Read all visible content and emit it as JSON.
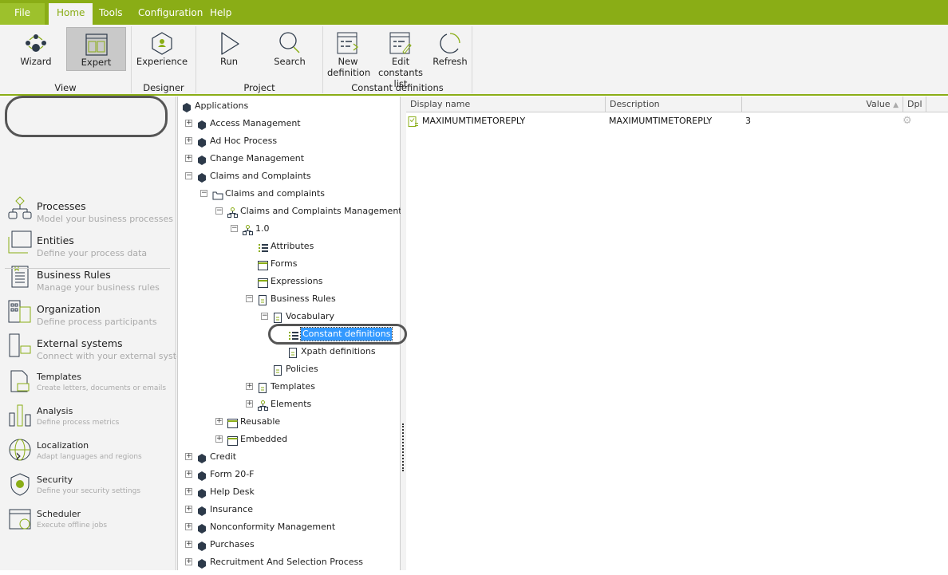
{
  "menu": {
    "tabs": [
      "File",
      "Home",
      "Tools",
      "Configuration",
      "Help"
    ],
    "active": "Home"
  },
  "ribbon": {
    "buttons": {
      "wizard": "Wizard",
      "expert": "Expert",
      "experience": "Experience",
      "run": "Run",
      "search": "Search",
      "new_definition": [
        "New",
        "definition"
      ],
      "edit_constants": [
        "Edit constants",
        "list"
      ],
      "refresh": "Refresh"
    },
    "groups": {
      "view": "View",
      "designer": "Designer",
      "project": "Project",
      "constant_definitions": "Constant definitions"
    }
  },
  "sidebar": {
    "items": [
      {
        "title": "Processes",
        "desc": "Model your business processes",
        "icon": "processes-icon"
      },
      {
        "title": "Entities",
        "desc": "Define your process data",
        "icon": "entities-icon"
      },
      {
        "title": "Business Rules",
        "desc": "Manage your business rules",
        "icon": "business-rules-icon"
      },
      {
        "title": "Organization",
        "desc": "Define process participants",
        "icon": "organization-icon"
      },
      {
        "title": "External systems",
        "desc": "Connect with your external systems",
        "icon": "external-systems-icon"
      },
      {
        "title": "Templates",
        "desc": "Create letters, documents  or emails",
        "icon": "templates-icon"
      },
      {
        "title": "Analysis",
        "desc": "Define process metrics",
        "icon": "analysis-icon"
      },
      {
        "title": "Localization",
        "desc": "Adapt languages and regions",
        "icon": "localization-icon"
      },
      {
        "title": "Security",
        "desc": "Define your security settings",
        "icon": "security-icon"
      },
      {
        "title": "Scheduler",
        "desc": "Execute offline jobs",
        "icon": "scheduler-icon"
      }
    ],
    "expand": "›"
  },
  "tree": [
    {
      "label": "Applications",
      "level": 0,
      "exp": "",
      "icon": "hex"
    },
    {
      "label": "Access Management",
      "level": 1,
      "exp": "+",
      "icon": "hex"
    },
    {
      "label": "Ad Hoc Process",
      "level": 1,
      "exp": "+",
      "icon": "hex"
    },
    {
      "label": "Change Management",
      "level": 1,
      "exp": "+",
      "icon": "hex"
    },
    {
      "label": "Claims and Complaints",
      "level": 1,
      "exp": "-",
      "icon": "hex"
    },
    {
      "label": "Claims and complaints",
      "level": 2,
      "exp": "-",
      "icon": "folder"
    },
    {
      "label": "Claims and Complaints Management",
      "level": 3,
      "exp": "-",
      "icon": "process"
    },
    {
      "label": "1.0",
      "level": 4,
      "exp": "-",
      "icon": "process"
    },
    {
      "label": "Attributes",
      "level": 5,
      "exp": "",
      "icon": "list"
    },
    {
      "label": "Forms",
      "level": 5,
      "exp": "",
      "icon": "form"
    },
    {
      "label": "Expressions",
      "level": 5,
      "exp": "",
      "icon": "form"
    },
    {
      "label": "Business Rules",
      "level": 5,
      "exp": "-",
      "icon": "doc"
    },
    {
      "label": "Vocabulary",
      "level": 6,
      "exp": "-",
      "icon": "doc"
    },
    {
      "label": "Constant definitions",
      "level": 7,
      "exp": "",
      "icon": "list",
      "selected": true
    },
    {
      "label": "Xpath definitions",
      "level": 7,
      "exp": "",
      "icon": "doc"
    },
    {
      "label": "Policies",
      "level": 6,
      "exp": "",
      "icon": "doc"
    },
    {
      "label": "Templates",
      "level": 5,
      "exp": "+",
      "icon": "doc"
    },
    {
      "label": "Elements",
      "level": 5,
      "exp": "+",
      "icon": "process"
    },
    {
      "label": "Reusable",
      "level": 3,
      "exp": "+",
      "icon": "form"
    },
    {
      "label": "Embedded",
      "level": 3,
      "exp": "+",
      "icon": "form"
    },
    {
      "label": "Credit",
      "level": 1,
      "exp": "+",
      "icon": "hex"
    },
    {
      "label": "Form 20-F",
      "level": 1,
      "exp": "+",
      "icon": "hex"
    },
    {
      "label": "Help Desk",
      "level": 1,
      "exp": "+",
      "icon": "hex"
    },
    {
      "label": "Insurance",
      "level": 1,
      "exp": "+",
      "icon": "hex"
    },
    {
      "label": "Nonconformity Management",
      "level": 1,
      "exp": "+",
      "icon": "hex"
    },
    {
      "label": "Purchases",
      "level": 1,
      "exp": "+",
      "icon": "hex"
    },
    {
      "label": "Recruitment And Selection Process",
      "level": 1,
      "exp": "+",
      "icon": "hex"
    }
  ],
  "grid": {
    "columns": [
      "Display name",
      "Description",
      "Value",
      "Dpl"
    ],
    "sort_indicator": "▲",
    "rows": [
      {
        "display_name": "MAXIMUMTIMETOREPLY",
        "description": "MAXIMUMTIMETOREPLY",
        "value": "3",
        "dpl": "gears-icon"
      }
    ]
  },
  "colors": {
    "accent": "#8aad16",
    "selection": "#3399ff"
  }
}
